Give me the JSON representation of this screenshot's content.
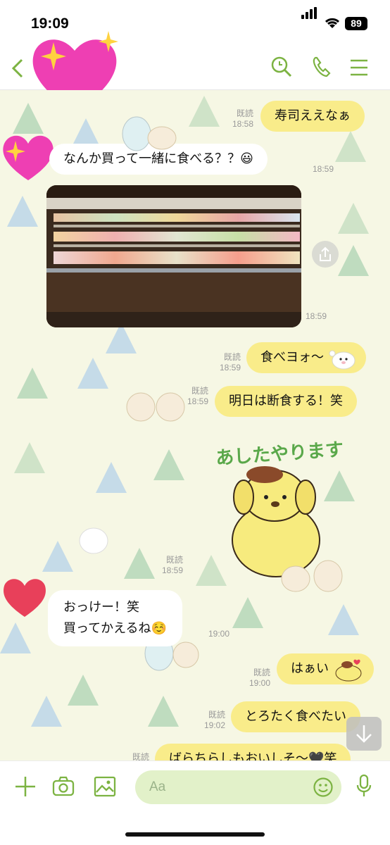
{
  "status": {
    "time": "19:09",
    "battery": "89"
  },
  "header": {
    "back": "back",
    "icons": [
      "search-icon",
      "phone-icon",
      "menu-icon"
    ]
  },
  "messages": {
    "m1": {
      "text": "寿司ええなぁ",
      "read": "既読",
      "time": "18:58"
    },
    "m2": {
      "text": "なんか買って一緒に食べる？？😃",
      "time": "18:59"
    },
    "m3": {
      "time": "18:59"
    },
    "m4": {
      "text": "食べヨォ〜",
      "read": "既読",
      "time": "18:59"
    },
    "m5": {
      "text": "明日は断食する！笑",
      "read": "既読",
      "time": "18:59"
    },
    "m6": {
      "sticker_text": "あしたやります",
      "read": "既読",
      "time": "18:59"
    },
    "m7": {
      "line1": "おっけー！笑",
      "line2": "買ってかえるね☺️",
      "time": "19:00"
    },
    "m8": {
      "text": "はぁい",
      "read": "既読",
      "time": "19:00"
    },
    "m9": {
      "text": "とろたく食べたい",
      "read": "既読",
      "time": "19:02"
    },
    "m10": {
      "text": "ばらちらしもおいしそ〜🖤笑",
      "read": "既読"
    }
  },
  "input": {
    "placeholder": "Aa"
  },
  "colors": {
    "accent": "#7cb342",
    "out_bubble": "#f9ec8a",
    "in_bubble": "#ffffff",
    "bg": "#f6f7e4"
  }
}
